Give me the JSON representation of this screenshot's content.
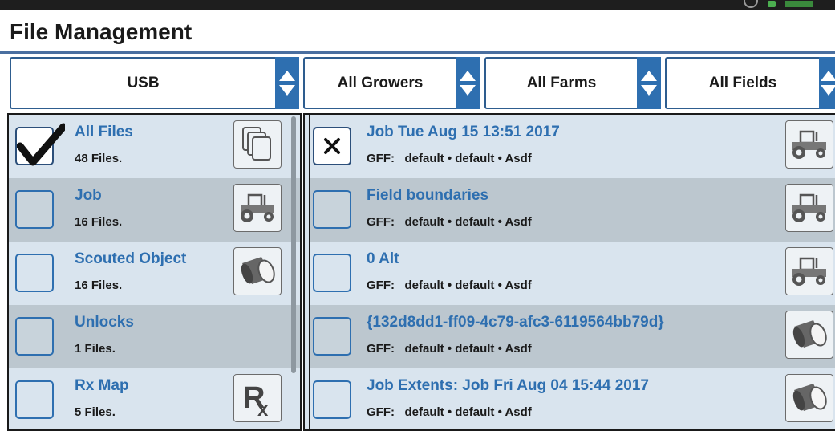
{
  "header": {
    "title": "File Management"
  },
  "selectors": {
    "source": "USB",
    "growers": "All Growers",
    "farms": "All Farms",
    "fields": "All Fields"
  },
  "categories": [
    {
      "title": "All Files",
      "count": "48 Files.",
      "checked": true,
      "icon": "files-icon"
    },
    {
      "title": "Job",
      "count": "16 Files.",
      "checked": false,
      "icon": "tractor-icon"
    },
    {
      "title": "Scouted Object",
      "count": "16 Files.",
      "checked": false,
      "icon": "marker-cylinder-icon"
    },
    {
      "title": "Unlocks",
      "count": "1 Files.",
      "checked": false,
      "icon": ""
    },
    {
      "title": "Rx Map",
      "count": "5 Files.",
      "checked": false,
      "icon": "rx-icon"
    }
  ],
  "files": [
    {
      "title": "Job Tue Aug 15 13:51 2017",
      "gff": "GFF:   default • default • Asdf",
      "selected": true,
      "icon": "tractor-icon"
    },
    {
      "title": "Field boundaries",
      "gff": "GFF:   default • default • Asdf",
      "selected": false,
      "icon": "tractor-icon"
    },
    {
      "title": "0 Alt",
      "gff": "GFF:   default • default • Asdf",
      "selected": false,
      "icon": "tractor-icon"
    },
    {
      "title": "{132d8dd1-ff09-4c79-afc3-6119564bb79d}",
      "gff": "GFF:   default • default • Asdf",
      "selected": false,
      "icon": "marker-cylinder-icon"
    },
    {
      "title": "Job Extents: Job Fri Aug 04 15:44 2017",
      "gff": "GFF:   default • default • Asdf",
      "selected": false,
      "icon": "marker-cylinder-icon"
    }
  ],
  "colors": {
    "accent": "#2e6fb0",
    "row_light": "#d9e4ee",
    "row_dark": "#bcc7cf"
  }
}
